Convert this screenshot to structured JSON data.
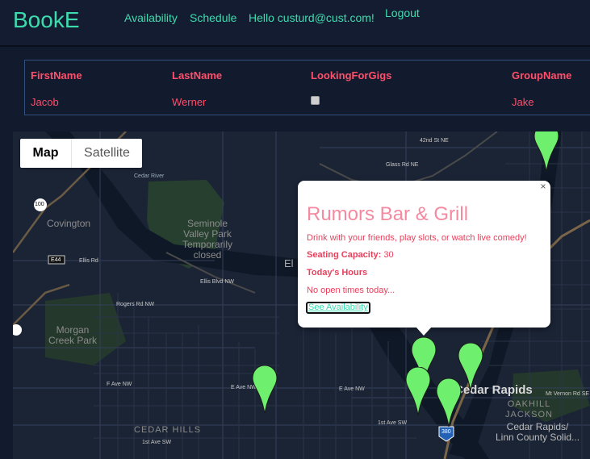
{
  "header": {
    "brand": "BookE",
    "nav": {
      "availability": "Availability",
      "schedule": "Schedule",
      "greeting": "Hello custurd@cust.com!",
      "logout": "Logout"
    }
  },
  "profile": {
    "columns": [
      "FirstName",
      "LastName",
      "LookingForGigs",
      "GroupName"
    ],
    "row": {
      "first_name": "Jacob",
      "last_name": "Werner",
      "looking_for_gigs": false,
      "group_name": "Jake"
    }
  },
  "map": {
    "type_control": {
      "map_label": "Map",
      "satellite_label": "Satellite",
      "selected": "Map"
    },
    "labels": {
      "covington": "Covington",
      "seminole": "Seminole\nValley Park\nTemporarily\nclosed",
      "morgan": "Morgan\nCreek Park",
      "cedar_hills": "CEDAR HILLS",
      "cedar_rapids": "Cedar Rapids",
      "oakhill": "OAKHILL\nJACKSON",
      "county": "Cedar Rapids/\nLinn County Solid...",
      "ellis_blvd": "Ellis Blvd NW",
      "ellis_rd": "Ellis Rd",
      "rogers": "Rogers Rd NW",
      "f_ave": "F Ave NW",
      "e_ave": "E Ave NW",
      "e_ave2": "E Ave NW",
      "first_ave": "1st Ave SW",
      "first_ave2": "1st Ave SW",
      "glass": "Glass Rd NE",
      "st42": "42nd St NE",
      "mt_vernon": "Mt Vernon Rd SE",
      "e44": "E44",
      "r100": "100",
      "i380": "380",
      "el": "El",
      "cedar_river": "Cedar River"
    },
    "markers": [
      {
        "name": "marker-north-east",
        "color": "#6ef06e"
      },
      {
        "name": "marker-rumors",
        "color": "#6ef06e"
      },
      {
        "name": "marker-downtown-1",
        "color": "#6ef06e"
      },
      {
        "name": "marker-downtown-2",
        "color": "#6ef06e"
      },
      {
        "name": "marker-downtown-3",
        "color": "#6ef06e"
      },
      {
        "name": "marker-west",
        "color": "#6ef06e"
      }
    ],
    "info_window": {
      "title": "Rumors Bar & Grill",
      "description": "Drink with your friends, play slots, or watch live comedy!",
      "capacity_label": "Seating Capacity:",
      "capacity_value": "30",
      "hours_label": "Today's Hours",
      "open_times": "No open times today...",
      "link": "See Availability",
      "close": "×"
    }
  },
  "colors": {
    "accent": "#3ddcae",
    "label": "#ff4f6a",
    "header_bg": "#141c31",
    "page_bg": "#121a2e",
    "marker": "#6ef06e"
  }
}
